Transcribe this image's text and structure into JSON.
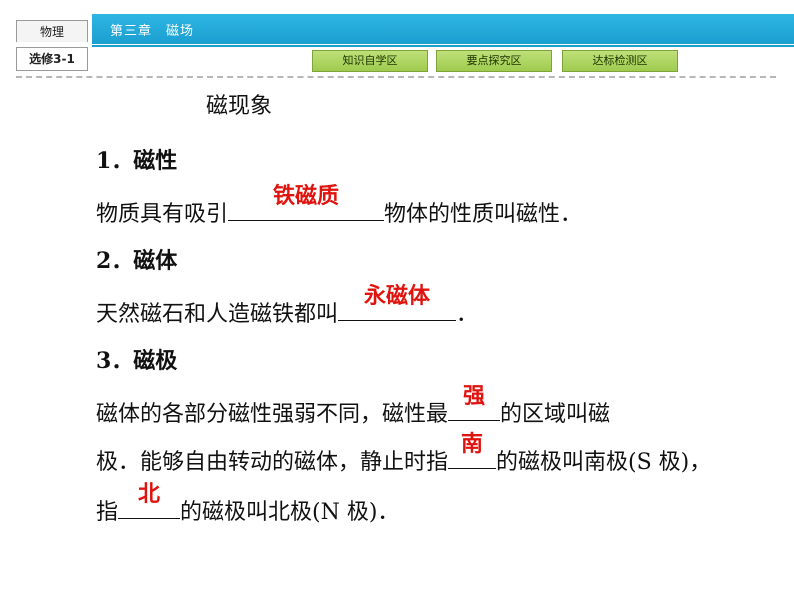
{
  "header": {
    "subject": "物理",
    "edition": "选修3-1",
    "chapter_title": "第三章　磁场",
    "nav": [
      "知识自学区",
      "要点探究区",
      "达标检测区"
    ]
  },
  "content": {
    "section_title": "磁现象",
    "h1": "1．磁性",
    "p1_before": "物质具有吸引",
    "p1_answer": "铁磁质",
    "p1_after": "物体的性质叫磁性．",
    "h2": "2．磁体",
    "p2_before": "天然磁石和人造磁铁都叫",
    "p2_answer": "永磁体",
    "p2_after": "．",
    "h3": "3．磁极",
    "p3a_before": "磁体的各部分磁性强弱不同，磁性最",
    "p3a_answer": "强",
    "p3a_after": "的区域叫磁",
    "p3b_before": "极．能够自由转动的磁体，静止时指",
    "p3b_answer": "南",
    "p3b_after": "的磁极叫南极(S 极)，",
    "p3c_before": "指",
    "p3c_answer": "北",
    "p3c_after": "的磁极叫北极(N 极)．"
  },
  "colors": {
    "header_band": "#1a9fd0",
    "nav_button": "#9fcb4e",
    "answer_text": "#e0140f"
  }
}
